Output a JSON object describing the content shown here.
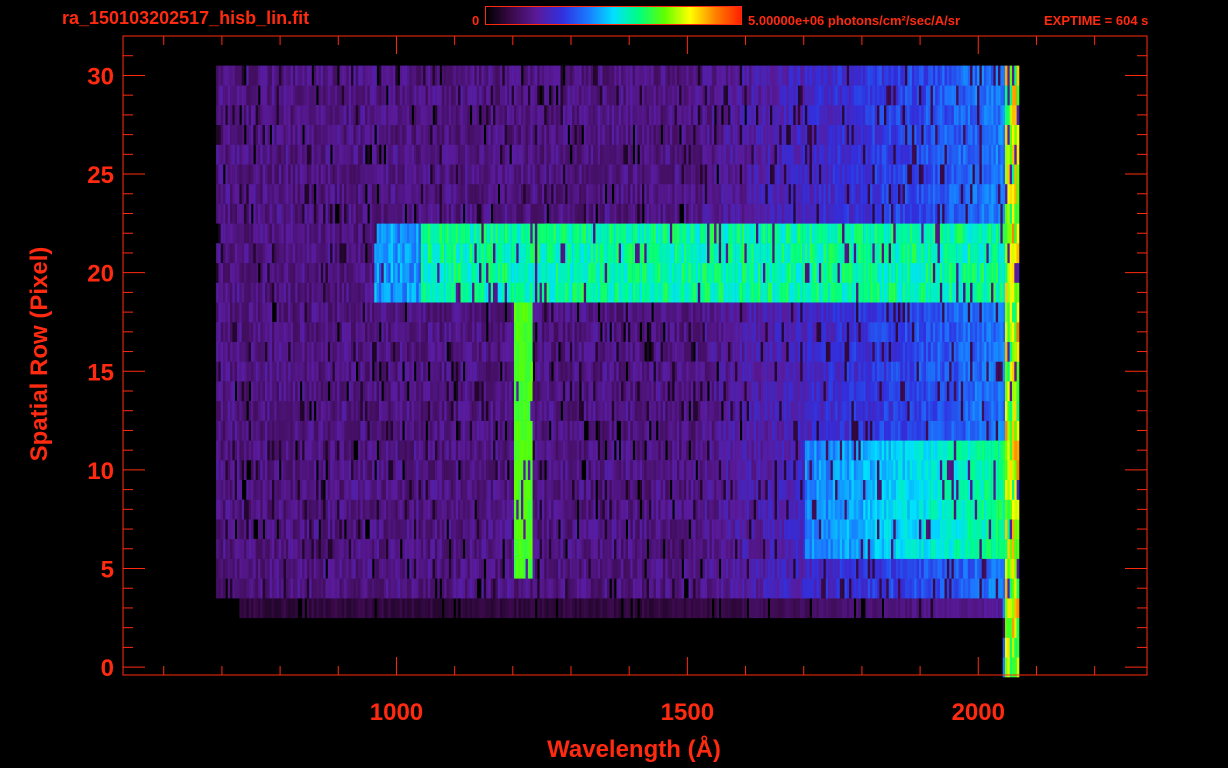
{
  "header": {
    "file_title": "ra_150103202517_hisb_lin.fit",
    "colorbar_min": "0",
    "colorbar_max_text": "5.00000e+06 photons/cm²/sec/A/sr",
    "exptime": "EXPTIME = 604 s"
  },
  "colors": {
    "annotation": "#ff2a10",
    "background": "#000000",
    "colormap": [
      "#000000",
      "#3a0a4a",
      "#5a1a9a",
      "#3030e0",
      "#1a7aff",
      "#00e0ff",
      "#00ff80",
      "#60ff00",
      "#ffff00",
      "#ff8000",
      "#ff2000"
    ]
  },
  "chart_data": {
    "type": "heatmap",
    "title": "ra_150103202517_hisb_lin.fit",
    "xlabel": "Wavelength (Å)",
    "ylabel": "Spatial Row (Pixel)",
    "xlim": [
      530,
      2290
    ],
    "ylim": [
      -0.4,
      32
    ],
    "xticks": [
      1000,
      1500,
      2000
    ],
    "yticks": [
      0,
      5,
      10,
      15,
      20,
      25,
      30
    ],
    "x_minor_step": 100,
    "y_minor_step": 1,
    "grid": false,
    "colorbar": {
      "min": 0,
      "max": 5000000,
      "units": "photons/cm²/sec/A/sr"
    },
    "rows": 31,
    "data_x_range": [
      690,
      2070
    ],
    "features": [
      {
        "label": "Lyman-alpha emission line",
        "x": 1216,
        "rows_from": 5,
        "rows_to": 19,
        "level": 0.65
      },
      {
        "label": "bright band",
        "x_from": 960,
        "x_to": 2050,
        "rows_from": 19,
        "rows_to": 23,
        "level": 0.5
      },
      {
        "label": "mid-UV continuum",
        "x_from": 1700,
        "x_to": 2055,
        "rows_from": 6,
        "rows_to": 12,
        "level": 0.5
      }
    ]
  }
}
